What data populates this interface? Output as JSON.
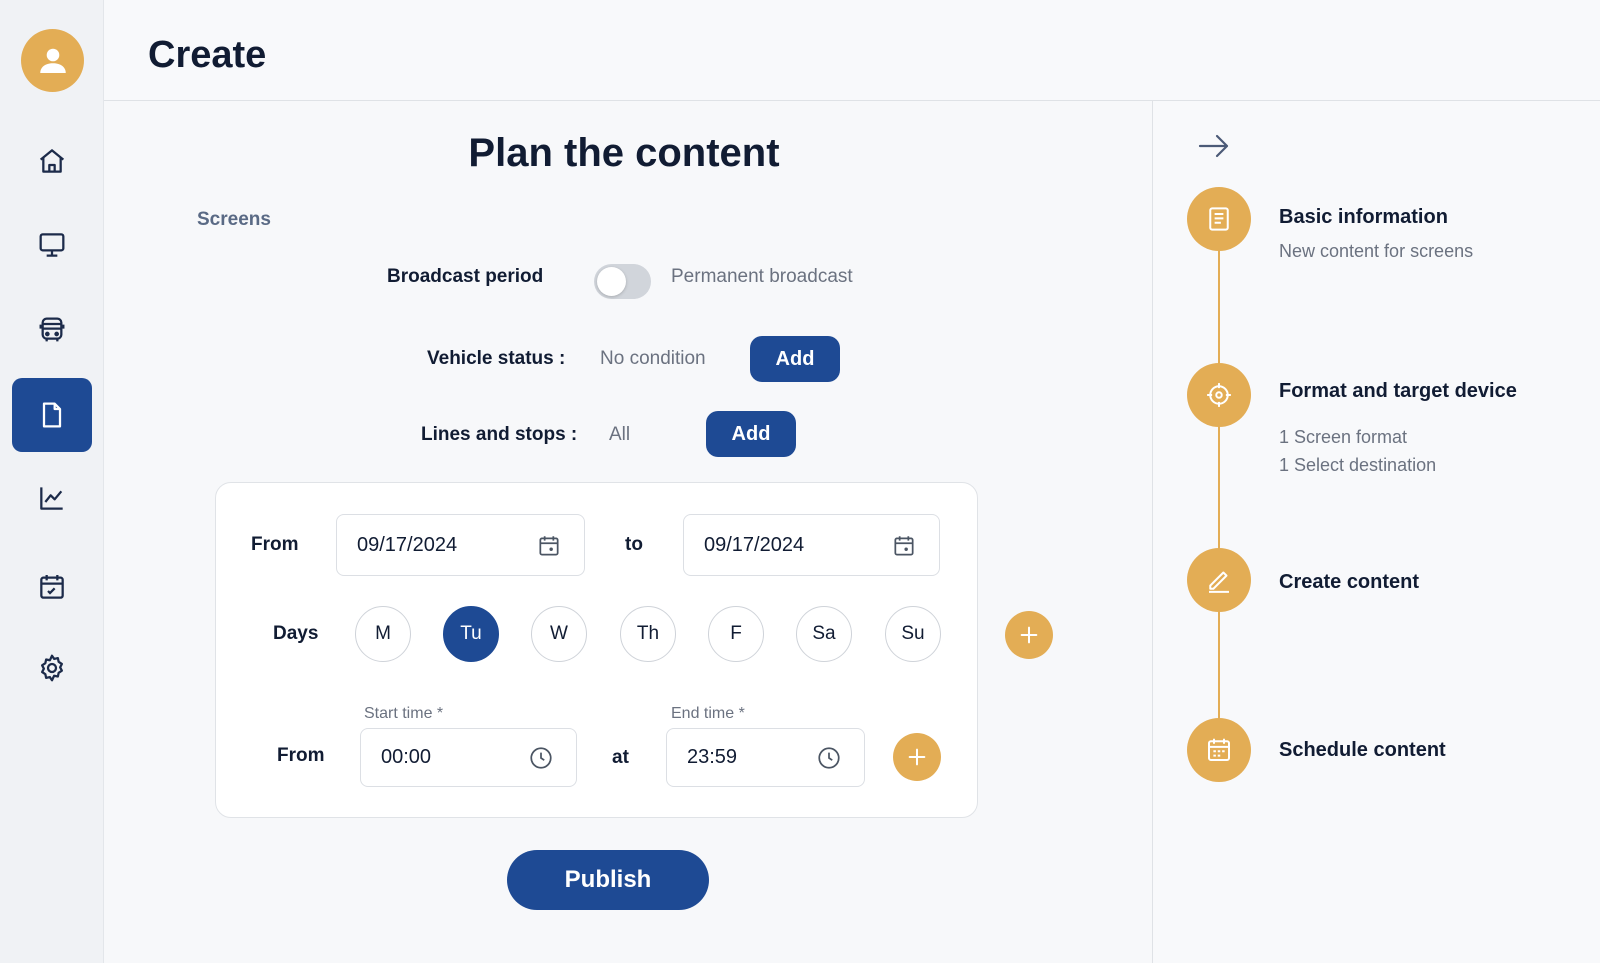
{
  "header": {
    "title": "Create"
  },
  "sidebar": {
    "items": [
      {
        "icon": "home-icon"
      },
      {
        "icon": "monitor-icon"
      },
      {
        "icon": "bus-icon"
      },
      {
        "icon": "document-icon",
        "active": true
      },
      {
        "icon": "chart-icon"
      },
      {
        "icon": "calendar-icon"
      },
      {
        "icon": "gear-icon"
      }
    ]
  },
  "main": {
    "title": "Plan the content",
    "section_label": "Screens",
    "broadcast": {
      "label": "Broadcast period",
      "value": "Permanent broadcast",
      "toggle_on": false
    },
    "vehicle": {
      "label": "Vehicle status :",
      "value": "No condition",
      "button": "Add"
    },
    "lines": {
      "label": "Lines and stops :",
      "value": "All",
      "button": "Add"
    },
    "schedule": {
      "from_label": "From",
      "from_date": "09/17/2024",
      "to_label": "to",
      "to_date": "09/17/2024",
      "days_label": "Days",
      "days": [
        {
          "label": "M",
          "selected": false
        },
        {
          "label": "Tu",
          "selected": true
        },
        {
          "label": "W",
          "selected": false
        },
        {
          "label": "Th",
          "selected": false
        },
        {
          "label": "F",
          "selected": false
        },
        {
          "label": "Sa",
          "selected": false
        },
        {
          "label": "Su",
          "selected": false
        }
      ],
      "time_from_label": "From",
      "start_caption": "Start time *",
      "start_time": "00:00",
      "at_label": "at",
      "end_caption": "End time *",
      "end_time": "23:59"
    },
    "publish": "Publish"
  },
  "steps": [
    {
      "title": "Basic information",
      "lines": [
        "New content for screens"
      ],
      "icon": "document-list-icon"
    },
    {
      "title": "Format and target device",
      "lines": [
        "1 Screen format",
        "1 Select destination"
      ],
      "icon": "target-icon"
    },
    {
      "title": "Create content",
      "lines": [],
      "icon": "pencil-icon"
    },
    {
      "title": "Schedule content",
      "lines": [],
      "icon": "calendar-icon"
    }
  ],
  "colors": {
    "primary": "#1e4a94",
    "accent": "#e3ad55"
  }
}
